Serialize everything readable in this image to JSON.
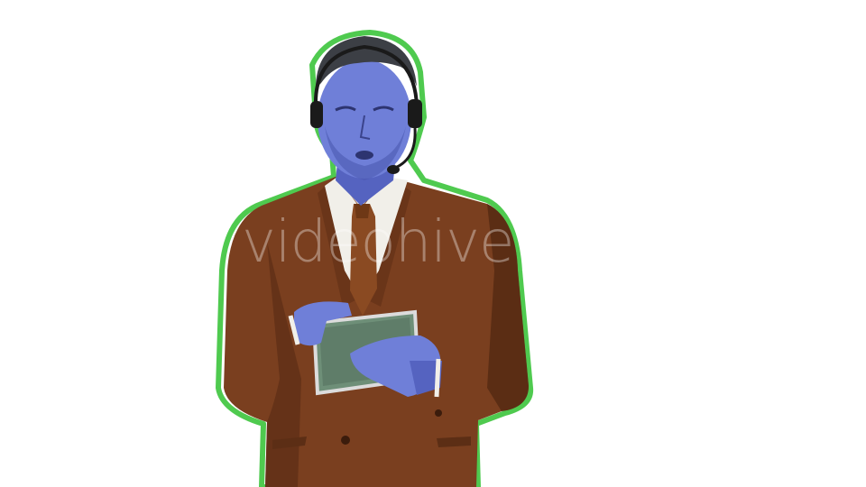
{
  "image": {
    "subject": "man-in-suit-with-headset-using-tablet",
    "watermark": "videohive",
    "colors": {
      "background": "#ffffff",
      "outline": "#3cc43c",
      "suit": "#7a3f1f",
      "suit_shadow": "#4f2610",
      "skin": "#6f7fd8",
      "skin_shadow": "#4b58b0",
      "hair": "#3c3f45",
      "shirt": "#f1efe9",
      "tie": "#8a4a22",
      "tablet": "#6e8f78",
      "headset": "#1a1a1a"
    }
  }
}
